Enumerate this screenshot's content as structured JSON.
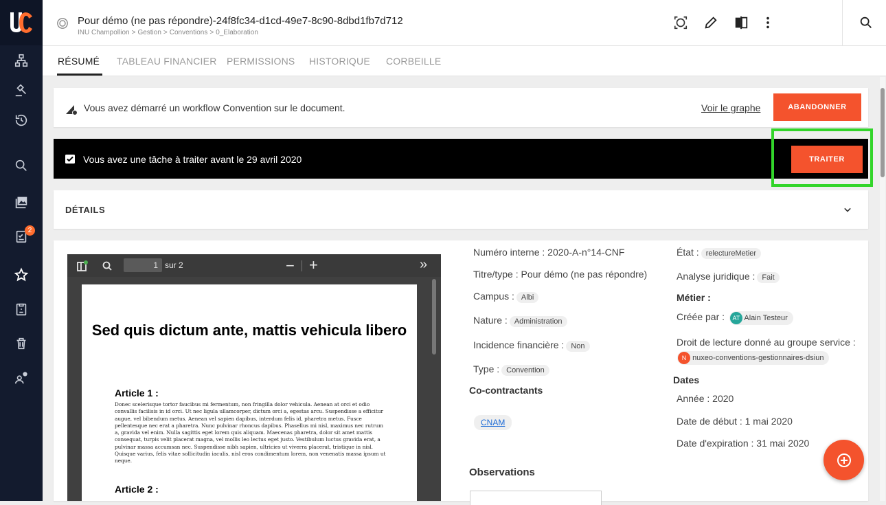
{
  "rail": {
    "logo_text": "UC",
    "items": [
      {
        "name": "structure"
      },
      {
        "name": "gavel"
      },
      {
        "name": "history"
      },
      {
        "name": "search"
      },
      {
        "name": "collections"
      },
      {
        "name": "tasks",
        "badge": "2"
      },
      {
        "name": "favorites"
      },
      {
        "name": "clipboard"
      },
      {
        "name": "trash"
      },
      {
        "name": "user-settings"
      }
    ]
  },
  "header": {
    "title": "Pour démo (ne pas répondre)-24f8fc34-d1cd-49e7-8c90-8dbd1fb7d712",
    "breadcrumb": [
      "INU Champollion",
      "Gestion",
      "Conventions",
      "0_Elaboration"
    ],
    "breadcrumb_sep": ">",
    "actions": [
      "focus-icon",
      "edit-icon",
      "compare-icon",
      "more-vert-icon",
      "search-icon"
    ]
  },
  "tabs": [
    "RÉSUMÉ",
    "TABLEAU FINANCIER",
    "PERMISSIONS",
    "HISTORIQUE",
    "CORBEILLE"
  ],
  "workflow": {
    "message": "Vous avez démarré un workflow Convention sur le document.",
    "link": "Voir le graphe",
    "button": "ABANDONNER"
  },
  "task": {
    "message": "Vous avez une tâche à traiter avant le 29 avril 2020",
    "button": "TRAITER"
  },
  "details": {
    "title": "DÉTAILS"
  },
  "viewer": {
    "page": "1",
    "of": "sur 2",
    "zoom_out": "−",
    "zoom_in": "+",
    "more": "»",
    "doc_title": "Sed quis dictum ante, mattis vehicula libero",
    "article1": "Article 1 :",
    "article1_body": "Donec scelerisque tortor faucibus mi fermentum, non fringilla dolor vehicula. Aenean at orci et odio convallis facilisis in id orci. Ut nec ligula ullamcorper, dictum orci a, egestas arcu. Suspendisse a efficitur augue, vel bibendum metus. Aenean vel sapien dapibus, interdum felis id, pharetra metus. Fusce pellentesque nec erat a pharetra. Nunc pulvinar rhoncus dapibus. Phasellus mi nisl, maximus nec rutrum a, gravida vel enim. Nulla sagittis eget lorem quis aliquam. Maecenas pharetra, dolor sit amet mattis consequat, turpis velit placerat magna, vel mollis leo lectus eget justo. Vestibulum luctus gravida erat, a pulvinar massa accumsan nec. Suspendisse nibh sapien, ultricies ut viverra placerat, tristique in nisl. Quisque varius, felis vitae sollicitudin iaculis, nisl eros condimentum lorem, non venenatis massa ipsum ut neque.",
    "article2": "Article 2 :"
  },
  "meta": {
    "numero_label": "Numéro interne :",
    "numero_value": "2020-A-n°14-CNF",
    "titre_label": "Titre/type :",
    "titre_value": "Pour démo (ne pas répondre)",
    "campus_label": "Campus :",
    "campus_value": "Albi",
    "nature_label": "Nature :",
    "nature_value": "Administration",
    "incidence_label": "Incidence financière :",
    "incidence_value": "Non",
    "type_label": "Type :",
    "type_value": "Convention",
    "cocontractants_title": "Co-contractants",
    "cocontractant": "CNAM",
    "observations_title": "Observations",
    "etat_label": "État :",
    "etat_value": "relectureMetier",
    "analyse_label": "Analyse juridique :",
    "analyse_value": "Fait",
    "metier_title": "Métier :",
    "creee_label": "Créée par :",
    "creee_initials": "AT",
    "creee_value": "Alain Testeur",
    "droit_label": "Droit de lecture donné au groupe service :",
    "droit_initial": "N",
    "droit_value": "nuxeo-conventions-gestionnaires-dsiun",
    "dates_title": "Dates",
    "annee": "Année : 2020",
    "debut": "Date de début : 1 mai 2020",
    "expiration": "Date d'expiration : 31 mai 2020"
  },
  "colors": {
    "accent": "#f4532d",
    "rail": "#131b2e",
    "highlight": "#32d52a",
    "avatar_at": "#26a69a",
    "avatar_n": "#f4532d"
  }
}
